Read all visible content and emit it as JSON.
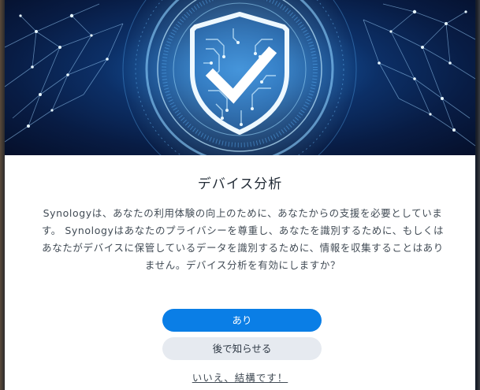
{
  "dialog": {
    "title": "デバイス分析",
    "body": "Synologyは、あなたの利用体験の向上のために、あなたからの支援を必要としています。 Synologyはあなたのプライバシーを尊重し、あなたを識別するために、もしくはあなたがデバイスに保管しているデータを識別するために、情報を収集することはありません。デバイス分析を有効にしますか？",
    "yes_label": "あり",
    "later_label": "後で知らせる",
    "no_label": "いいえ、結構です！"
  },
  "hero": {
    "icon": "shield-check-icon"
  },
  "colors": {
    "primary": "#0a7ee6",
    "secondary_button": "#e6eaf0",
    "title_text": "#222b36",
    "body_text": "#414b55"
  }
}
